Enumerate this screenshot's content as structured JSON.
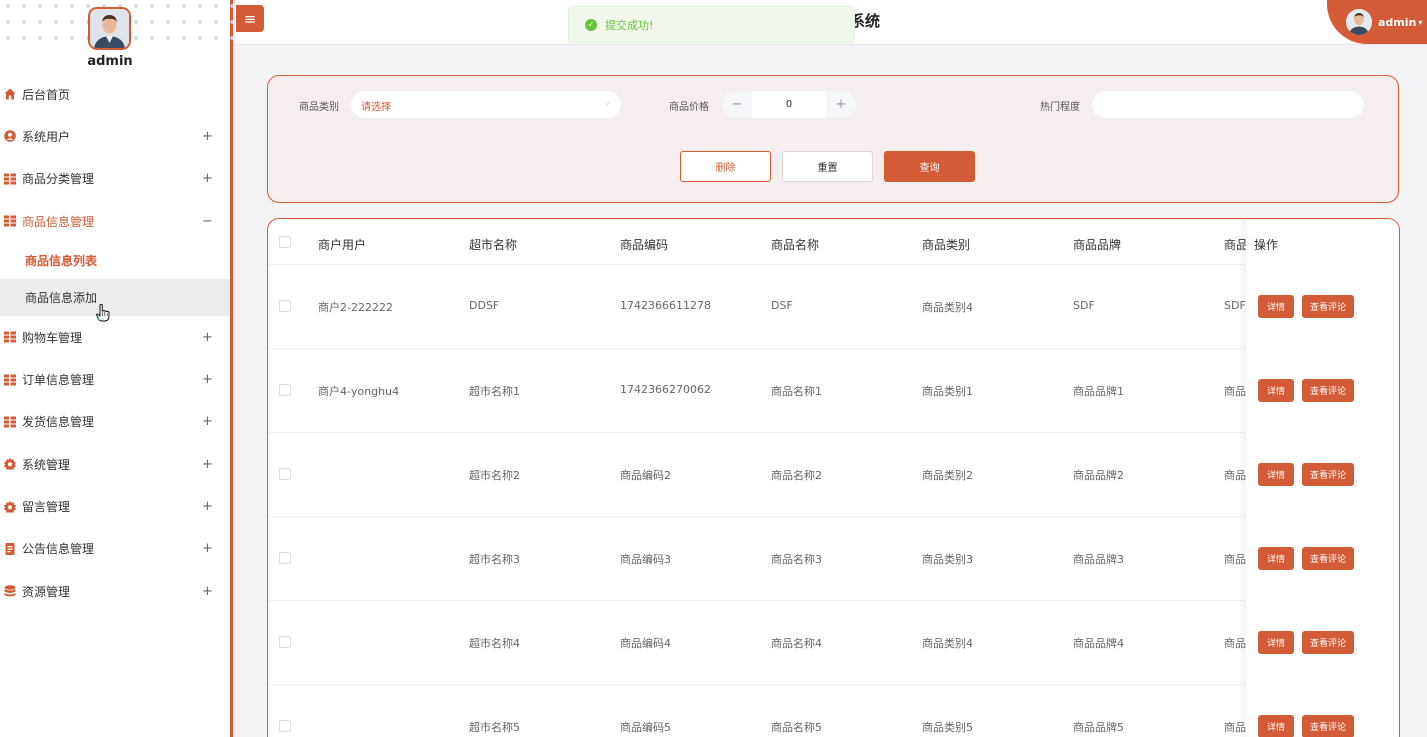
{
  "sidebar": {
    "username": "admin",
    "menu": [
      {
        "label": "后台首页",
        "icon": "home-icon",
        "expander": ""
      },
      {
        "label": "系统用户",
        "icon": "user-icon",
        "expander": "+"
      },
      {
        "label": "商品分类管理",
        "icon": "grid-icon",
        "expander": "+"
      },
      {
        "label": "商品信息管理",
        "icon": "grid-icon",
        "expander": "−"
      },
      {
        "label": "购物车管理",
        "icon": "grid-icon",
        "expander": "+"
      },
      {
        "label": "订单信息管理",
        "icon": "grid-icon",
        "expander": "+"
      },
      {
        "label": "发货信息管理",
        "icon": "grid-icon",
        "expander": "+"
      },
      {
        "label": "系统管理",
        "icon": "gear-icon",
        "expander": "+"
      },
      {
        "label": "留言管理",
        "icon": "gear-icon",
        "expander": "+"
      },
      {
        "label": "公告信息管理",
        "icon": "document-icon",
        "expander": "+"
      },
      {
        "label": "资源管理",
        "icon": "database-icon",
        "expander": "+"
      }
    ],
    "submenu": [
      "商品信息列表",
      "商品信息添加"
    ]
  },
  "header": {
    "title": "系统",
    "toast": "提交成功!",
    "user": "admin"
  },
  "search": {
    "category_label": "商品类别",
    "category_placeholder": "请选择",
    "price_label": "商品价格",
    "price_value": "0",
    "hot_label": "热门程度",
    "hot_value": "",
    "delete": "删除",
    "reset": "重置",
    "query": "查询"
  },
  "table": {
    "columns": [
      "商户用户",
      "超市名称",
      "商品编码",
      "商品名称",
      "商品类别",
      "商品品牌",
      "商品",
      "操作"
    ],
    "detail_label": "详情",
    "comment_label": "查看评论",
    "rows": [
      [
        "商户2-222222",
        "DDSF",
        "1742366611278",
        "DSF",
        "商品类别4",
        "SDF",
        "SDF"
      ],
      [
        "商户4-yonghu4",
        "超市名称1",
        "1742366270062",
        "商品名称1",
        "商品类别1",
        "商品品牌1",
        "商品"
      ],
      [
        "",
        "超市名称2",
        "商品编码2",
        "商品名称2",
        "商品类别2",
        "商品品牌2",
        "商品"
      ],
      [
        "",
        "超市名称3",
        "商品编码3",
        "商品名称3",
        "商品类别3",
        "商品品牌3",
        "商品"
      ],
      [
        "",
        "超市名称4",
        "商品编码4",
        "商品名称4",
        "商品类别4",
        "商品品牌4",
        "商品"
      ],
      [
        "",
        "超市名称5",
        "商品编码5",
        "商品名称5",
        "商品类别5",
        "商品品牌5",
        "商品"
      ]
    ]
  },
  "colors": {
    "accent": "#d35c36",
    "success": "#67c23a"
  }
}
